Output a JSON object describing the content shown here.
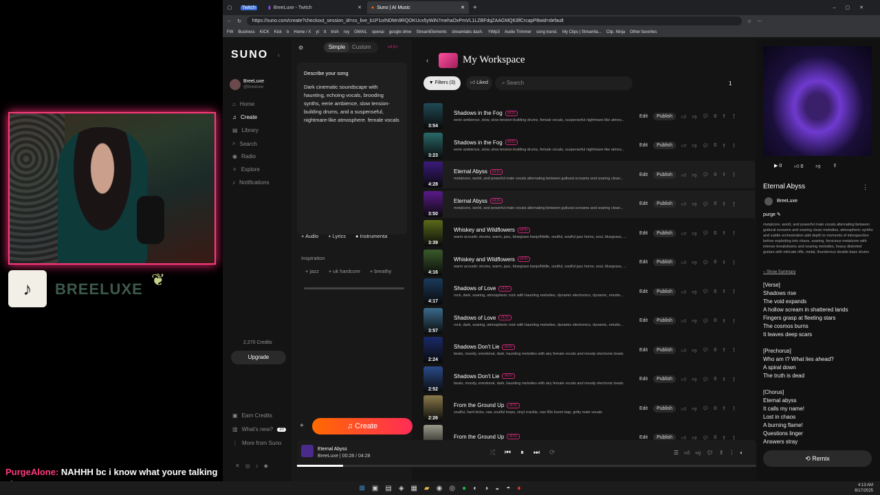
{
  "stream": {
    "brand": "BREELUXE",
    "chat_user": "PurgeAlone:",
    "chat_msg": " NAHHH bc i know what youre talking about to"
  },
  "browser": {
    "tabs": [
      {
        "label": "Twitch"
      },
      {
        "label": "BreeLuxe - Twitch"
      },
      {
        "label": "Suno | AI Music"
      }
    ],
    "url": "https://suno.com/create?checkout_session_id=cs_live_b1P1oINDMn9RQOKUcx5yWiN7mehaOxPmVL1LZBFdqZAAGMQ63lfCrcapP8wid=default",
    "bookmarks": [
      "FW",
      "Business",
      "KICK",
      "Kick",
      "b",
      "Home / X",
      "yt",
      "tt",
      "trish",
      "roy",
      "GMAIL",
      "openai",
      "google drive",
      "StreamElements",
      "streamlabs dash.",
      "YtMp3",
      "Audio Trimmer",
      "song transl.",
      "My Clips | Streamla...",
      "Clip. Ninja",
      "Other favorites"
    ]
  },
  "sidebar": {
    "logo": "SUNO",
    "user": "BreeLuxe",
    "handle": "@breeluxe",
    "nav": [
      "Home",
      "Create",
      "Library",
      "Search",
      "Radio",
      "Explore",
      "Notifications"
    ],
    "credits": "2,270 Credits",
    "upgrade": "Upgrade",
    "earn": "Earn Credits",
    "whats_new": "What's new?",
    "whats_new_count": "20",
    "more": "More from Suno"
  },
  "create": {
    "mode_simple": "Simple",
    "mode_custom": "Custom",
    "version": "v4.5+",
    "describe_label": "Describe your song",
    "describe_text": "Dark cinematic soundscape with haunting, echoing vocals, brooding synths, eerie ambience, slow tension-building drums, and a suspenseful, nightmare-like atmosphere. female vocals",
    "audio": "Audio",
    "lyrics": "Lyrics",
    "instrumental": "Instrumenta",
    "inspiration": "Inspiration",
    "tags": [
      "jazz",
      "uk hardcore",
      "breathy"
    ],
    "create_btn": "Create"
  },
  "workspace": {
    "title": "My Workspace",
    "filters": "Filters (3)",
    "liked": "Liked",
    "search_placeholder": "Search",
    "page": "1",
    "edit": "Edit",
    "publish": "Publish",
    "badge": "v4.5+",
    "songs": [
      {
        "title": "Shadows in the Fog",
        "desc": "eerie ambience, slow, slow tension-building drums, female vocals, suspenseful nightmare-like atmos...",
        "dur": "3:54",
        "color": "#1f4a55",
        "count": "0"
      },
      {
        "title": "Shadows in the Fog",
        "desc": "eerie ambience, slow, slow tension-building drums, female vocals, suspenseful nightmare-like atmos...",
        "dur": "3:23",
        "color": "#2a6a6a",
        "count": "0"
      },
      {
        "title": "Eternal Abyss",
        "desc": "metalcore, world, and powerful male vocals alternating between guttural screams and soaring clean...",
        "dur": "4:28",
        "color": "#3a1a7a",
        "count": "0"
      },
      {
        "title": "Eternal Abyss",
        "desc": "metalcore, world, and powerful male vocals alternating between guttural screams and soaring clean...",
        "dur": "3:50",
        "color": "#5a1a8a",
        "count": "0"
      },
      {
        "title": "Whiskey and Wildflowers",
        "desc": "warm acoustic strums, warm, jazz, bluegrass banjo/fiddle, soulful, soulful jazz horns, soul, bluegrass, ...",
        "dur": "3:39",
        "color": "#5a6a1a",
        "count": "0"
      },
      {
        "title": "Whiskey and Wildflowers",
        "desc": "warm acoustic strums, warm, jazz, bluegrass banjo/fiddle, soulful, soulful jazz horns, soul, bluegrass, ...",
        "dur": "4:16",
        "color": "#3a5a2a",
        "count": "0"
      },
      {
        "title": "Shadows of Love",
        "desc": "rock, dark, soaring, atmospheric rock with haunting melodies, dynamic electronics, dynamic, emotio...",
        "dur": "4:17",
        "color": "#1a3a5a",
        "count": "0"
      },
      {
        "title": "Shadows of Love",
        "desc": "rock, dark, soaring, atmospheric rock with haunting melodies, dynamic electronics, dynamic, emotio...",
        "dur": "3:57",
        "color": "#3a6a8a",
        "count": "0"
      },
      {
        "title": "Shadows Don't Lie",
        "desc": "beats, moody, emotional, dark, haunting melodies with airy female vocals and moody electronic beats",
        "dur": "2:24",
        "color": "#1a2a6a",
        "count": "0"
      },
      {
        "title": "Shadows Don't Lie",
        "desc": "beats, moody, emotional, dark, haunting melodies with airy female vocals and moody electronic beats",
        "dur": "2:52",
        "color": "#2a4a8a",
        "count": "0"
      },
      {
        "title": "From the Ground Up",
        "desc": "soulful, hard kicks, raw, soulful loops, vinyl crackle, raw 90s boom bap, gritty male vocals",
        "dur": "2:26",
        "color": "#8a7a4a",
        "count": "0"
      },
      {
        "title": "From the Ground Up",
        "desc": "",
        "dur": "",
        "color": "#9a9a8a",
        "count": "0"
      }
    ]
  },
  "player": {
    "title": "Eternal Abyss",
    "artist": "BreeLuxe",
    "time": "00:28 / 04:28",
    "progress": 0.1
  },
  "detail": {
    "title": "Eternal Abyss",
    "artist": "BreeLuxe",
    "tag": "purge",
    "desc": "metalcore, world, and powerful male vocals alternating between guttural screams and soaring clean melodies, atmospheric synths and subtle orchestration add depth to moments of introspection before exploding into chaos, soaring, ferocious metalcore with intense breakdowns and soaring melodies, heavy distorted guitars with intricate riffs, metal, thunderous double bass drums",
    "show_summary": "Show Summary",
    "plays": "0",
    "likes": "0",
    "lyrics": "[Verse]\nShadows rise\nThe void expands\nA hollow scream in shattered lands\nFingers grasp at fleeting stars\nThe cosmos burns\nIt leaves deep scars\n\n[Prechorus]\nWho am I? What lies ahead?\nA spiral down\nThe truth is dead\n\n[Chorus]\nEternal abyss\nIt calls my name!\nLost in chaos\nA burning flame!\nQuestions linger\nAnswers stray",
    "remix": "Remix"
  },
  "taskbar": {
    "time": "4:13 AM",
    "date": "8/17/2025"
  }
}
